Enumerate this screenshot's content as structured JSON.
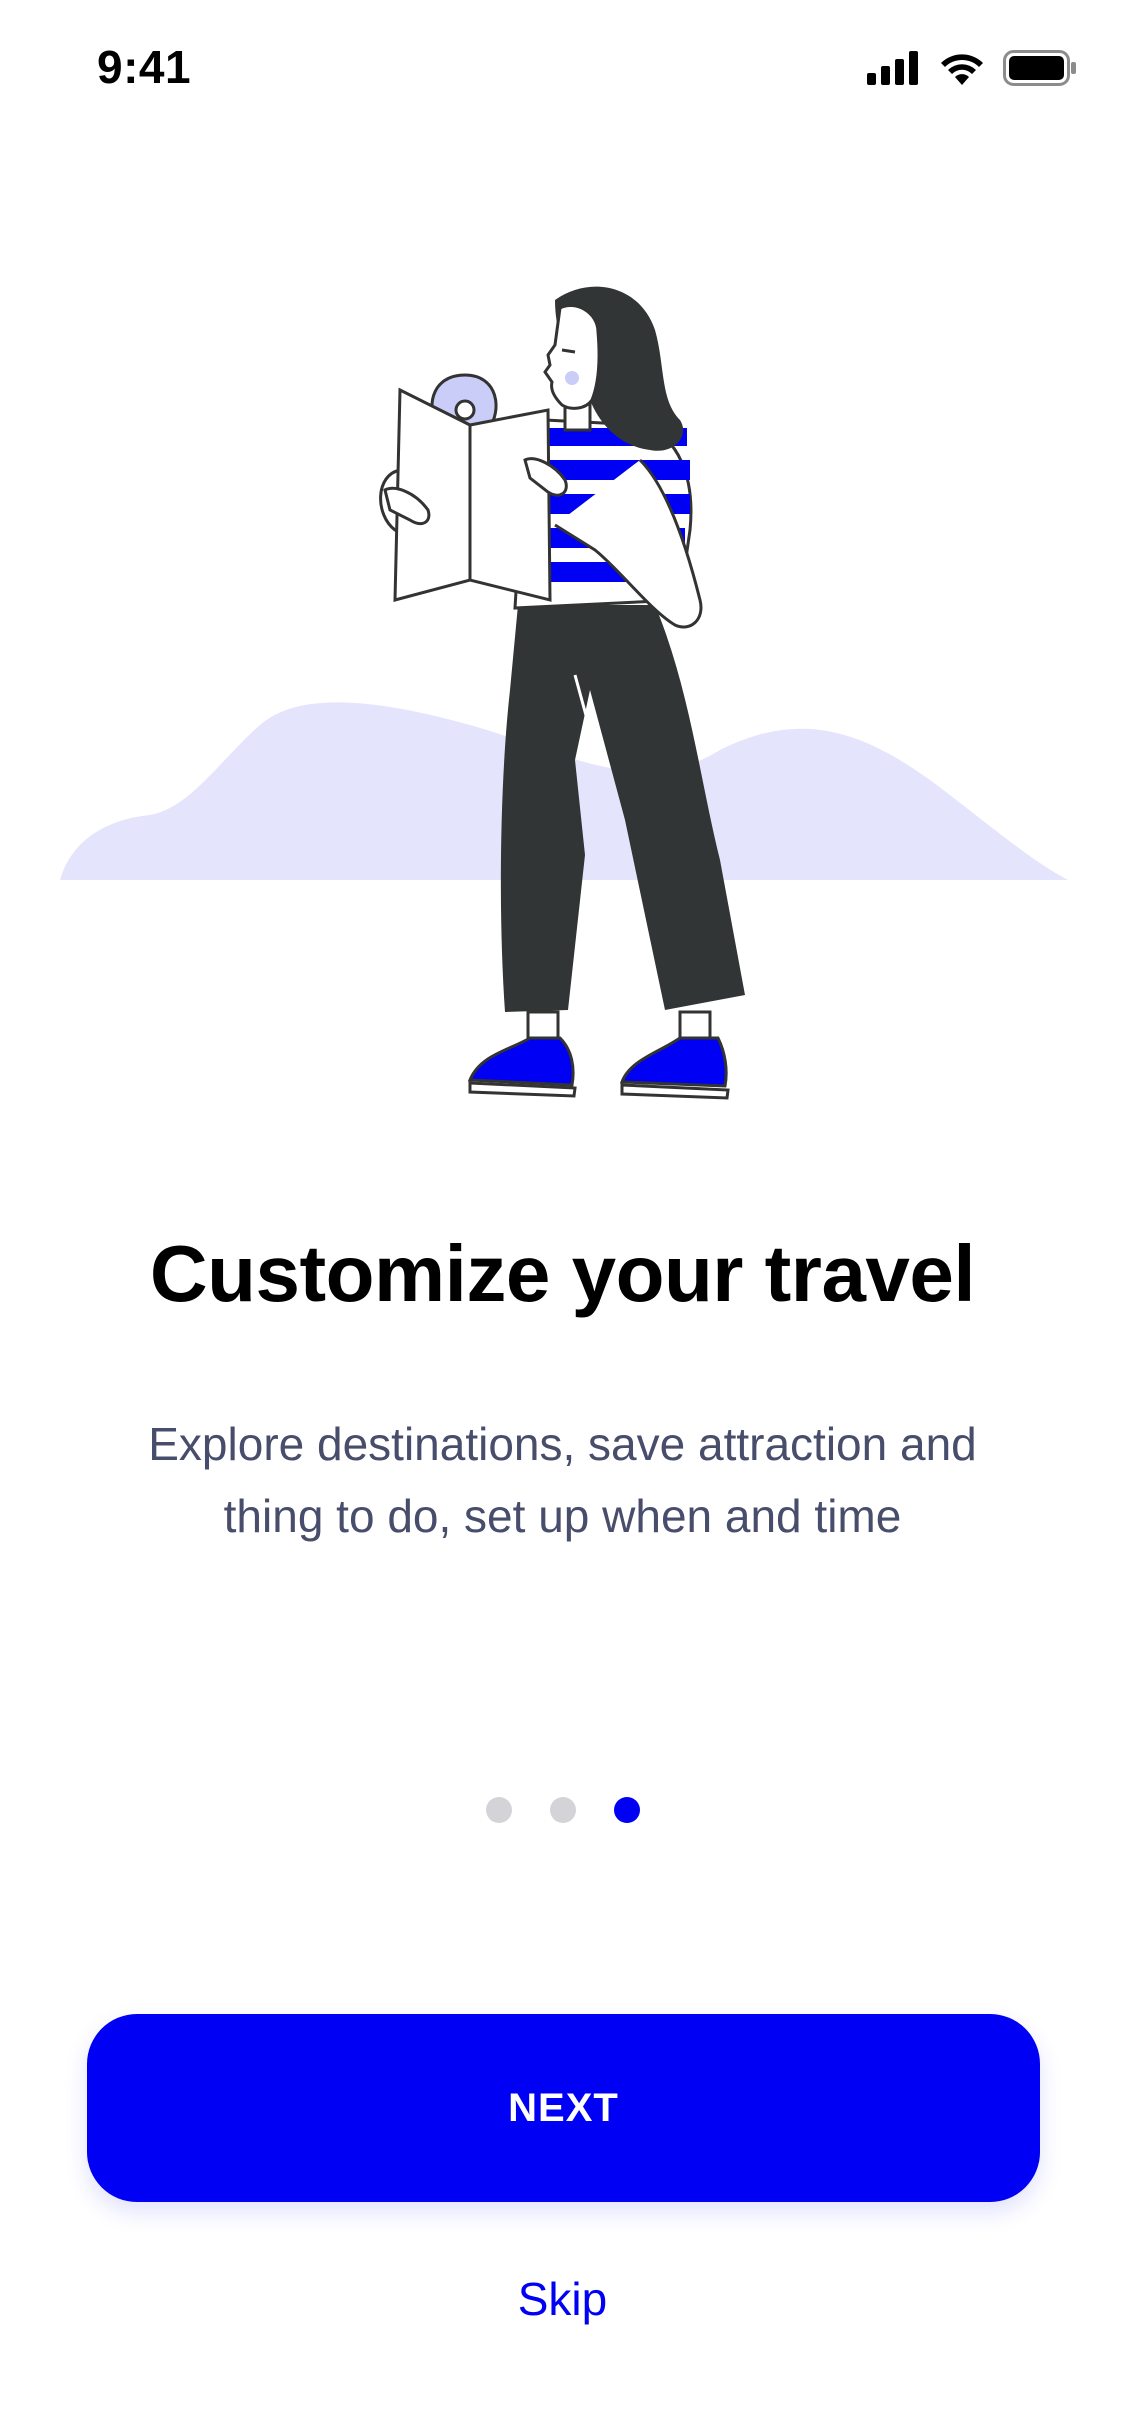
{
  "status_bar": {
    "time": "9:41",
    "icons": [
      "cellular-signal-icon",
      "wifi-icon",
      "battery-icon"
    ]
  },
  "onboarding": {
    "illustration": "woman-reading-map-illustration",
    "title": "Customize your travel",
    "subtitle": "Explore destinations, save attraction and thing to do, set up when and time",
    "pager": {
      "total": 3,
      "current": 3
    }
  },
  "actions": {
    "next_label": "NEXT",
    "skip_label": "Skip"
  },
  "colors": {
    "accent": "#0000f5",
    "background": "#ffffff",
    "title": "#000000",
    "subtitle": "#474d6b",
    "hills": "#e4e4fc",
    "inactive_dot": "#d4d4d8",
    "dark": "#323536"
  }
}
